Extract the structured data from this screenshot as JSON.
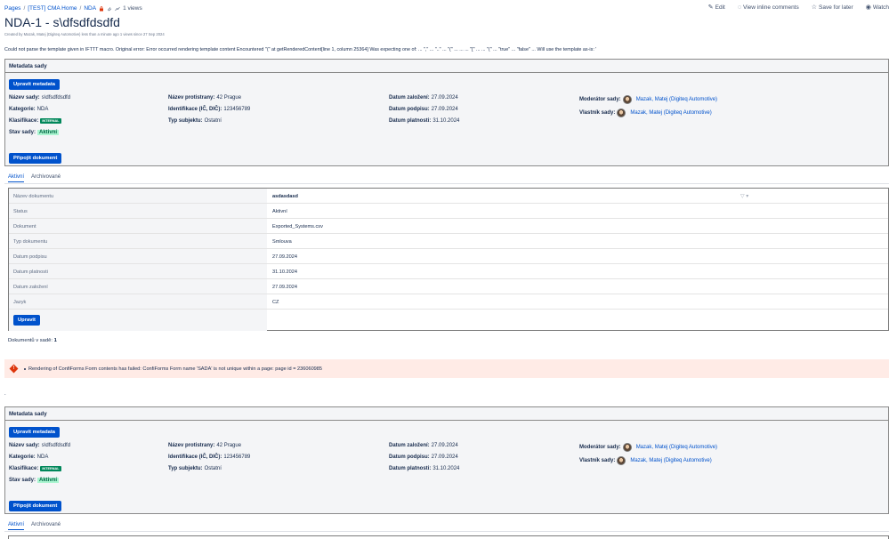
{
  "breadcrumb": {
    "items": [
      "Pages",
      "[TEST] CMA Home",
      "NDA"
    ],
    "separator": "/",
    "views": "1 views"
  },
  "top_actions": {
    "edit": "Edit",
    "view_inline": "View inline comments",
    "save_later": "Save for later",
    "watch": "Watch"
  },
  "page": {
    "title": "NDA-1 - s\\dfsdfdsdfd",
    "byline": "Created by Mazak, Matej (Digiteq Automotive) less than a minute ago  1 views since 27 Sep 2024",
    "error": "Could not parse the template given in IFTTT macro. Original error: Error occurred rendering template content Encountered \"(\" at getRenderedContent[line 1, column 25364] Was expecting one of: ... \",\" ... \"..\" ... \"(\" ... ... ... \"[\" ... ... \"(\" ... \"true\" ... \"false\" ... Will use the template as-is: '"
  },
  "metadata": {
    "header": "Metadata sady",
    "edit_button": "Upravit metadata",
    "attach_button": "Připojit dokument",
    "name_label": "Název sady:",
    "name_value": "s\\dfsdfdsdfd",
    "category_label": "Kategorie:",
    "category_value": "NDA",
    "classification_label": "Klasifikace:",
    "classification_value": "INTERNAL",
    "state_label": "Stav sady:",
    "state_value": "Aktivní",
    "counterparty_label": "Název protistrany:",
    "counterparty_value": "42 Prague",
    "id_label": "Identifikace (IČ, DIČ):",
    "id_value": "123456789",
    "subject_type_label": "Typ subjektu:",
    "subject_type_value": "Ostatní",
    "created_label": "Datum založení:",
    "created_value": "27.09.2024",
    "signed_label": "Datum podpisu:",
    "signed_value": "27.09.2024",
    "validity_label": "Datum platnosti:",
    "validity_value": "31.10.2024",
    "moderator_label": "Moderátor sady:",
    "moderator_value": "Mazak, Matej (Digiteq Automotive)",
    "owner_label": "Vlastník sady:",
    "owner_value": "Mazak, Matej (Digiteq Automotive)"
  },
  "tabs": {
    "active": "Aktivní",
    "archived": "Archivované"
  },
  "document": {
    "rows": [
      {
        "label": "Název dokumentu",
        "value": "asdasdasd"
      },
      {
        "label": "Status",
        "value": "Aktivní"
      },
      {
        "label": "Dokument",
        "value": "Exported_Systems.csv"
      },
      {
        "label": "Typ dokumentu",
        "value": "Smlouva"
      },
      {
        "label": "Datum podpisu",
        "value": "27.09.2024"
      },
      {
        "label": "Datum platnosti",
        "value": "31.10.2024"
      },
      {
        "label": "Datum založení",
        "value": "27.09.2024"
      },
      {
        "label": "Jazyk",
        "value": "CZ"
      }
    ],
    "edit_button": "Upravit"
  },
  "count": {
    "label": "Dokumentů v sadě:",
    "value": "1"
  },
  "alert": {
    "message": "Rendering of ConfiForms Form contents has failed: ConfiForms Form name 'SADA' is not unique within a page: page id = 236060985"
  },
  "dot": ".",
  "colors": {
    "primary": "#0052cc",
    "alert_bg": "#ffebe6",
    "internal_badge": "#00875a",
    "active_badge": "#abf5d1"
  }
}
